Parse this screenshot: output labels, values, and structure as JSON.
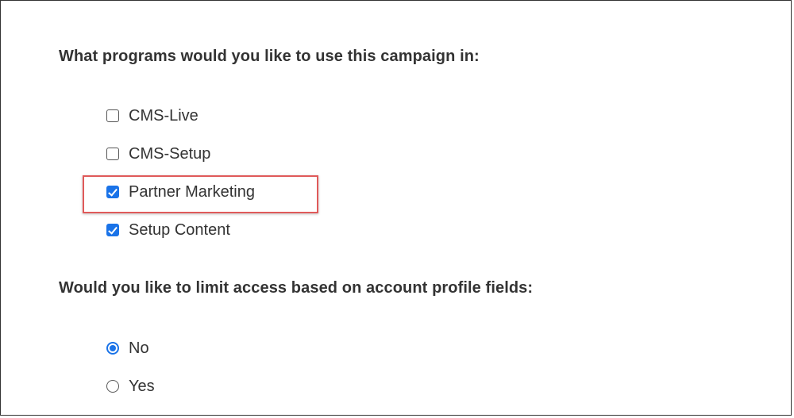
{
  "programs_question": "What programs would you like to use this campaign in:",
  "programs": [
    {
      "label": "CMS-Live",
      "checked": false
    },
    {
      "label": "CMS-Setup",
      "checked": false
    },
    {
      "label": "Partner Marketing",
      "checked": true
    },
    {
      "label": "Setup Content",
      "checked": true
    }
  ],
  "access_question": "Would you like to limit access based on account profile fields:",
  "access_options": [
    {
      "label": "No",
      "selected": true
    },
    {
      "label": "Yes",
      "selected": false
    }
  ],
  "colors": {
    "accent": "#1a73e8",
    "highlight": "#e05a5a"
  }
}
